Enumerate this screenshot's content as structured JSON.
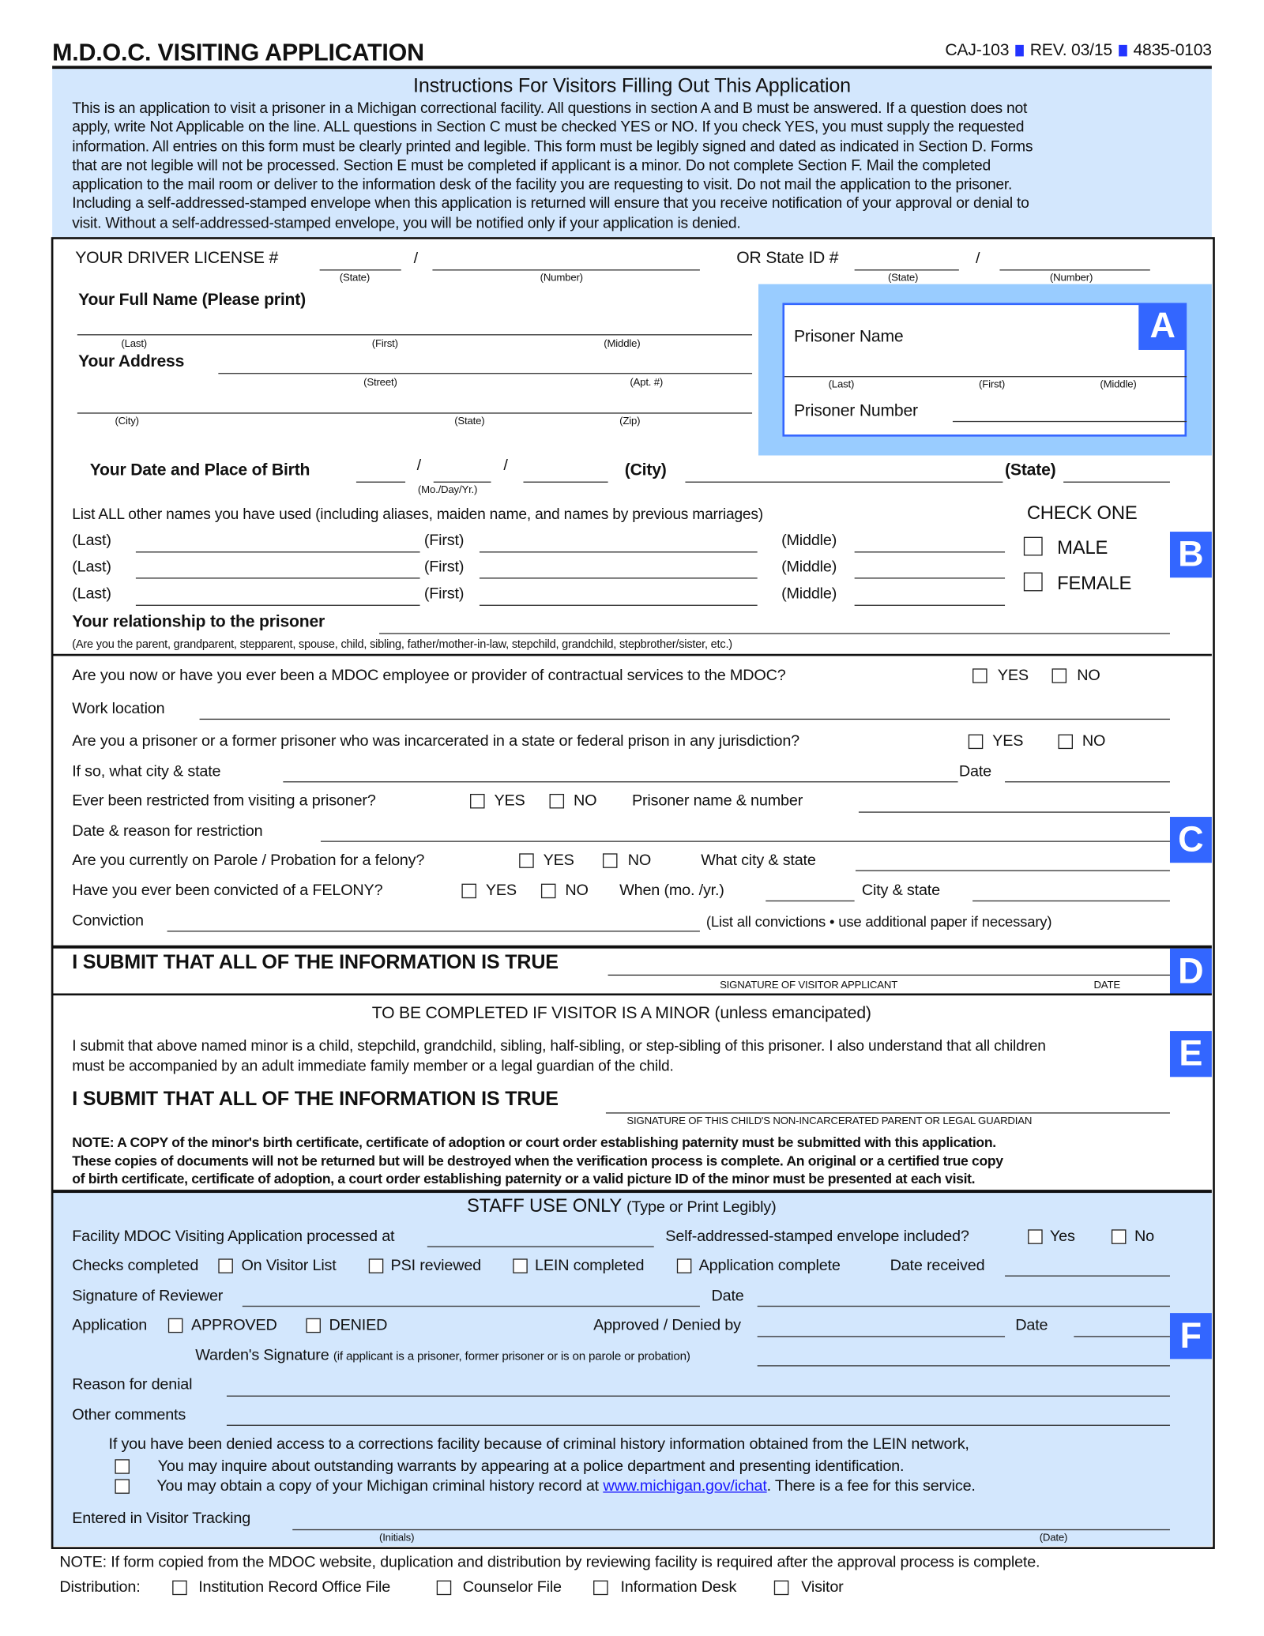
{
  "header": {
    "title": "M.D.O.C. VISITING APPLICATION",
    "form_no": "CAJ-103",
    "rev": "REV. 03/15",
    "code": "4835-0103"
  },
  "instructions": {
    "heading": "Instructions For Visitors Filling Out This Application",
    "lines": [
      "This is an application to visit a prisoner in a Michigan correctional facility.  All questions in section A and B must be answered. If a question does not",
      "apply, write Not Applicable on the line. ALL questions in Section C must be checked YES or NO. If you check YES, you must supply the requested",
      "information.  All entries on this form must be clearly printed and legible. This form must be legibly signed and dated as indicated in Section D. Forms",
      "that are not legible will not be processed. Section E must be completed if applicant is a minor. Do not complete Section F. Mail the completed",
      "application to the mail room or deliver to the information desk of the facility you are requesting to visit.  Do not mail the application to the prisoner.",
      "Including a self-addressed-stamped envelope when this application is returned will ensure that you receive notification of your approval or denial to",
      "visit.  Without a self-addressed-stamped envelope, you will be notified only if your application is denied."
    ]
  },
  "license": {
    "label": "YOUR DRIVER LICENSE #",
    "slash": "/",
    "state": "(State)",
    "number": "(Number)",
    "state_id_label": "OR State ID #"
  },
  "section_a": {
    "letter": "A",
    "prisoner_name": "Prisoner Name",
    "last": "(Last)",
    "first": "(First)",
    "middle": "(Middle)",
    "prisoner_number": "Prisoner Number"
  },
  "personal": {
    "full_name": "Your Full Name (Please print)",
    "last": "(Last)",
    "first": "(First)",
    "middle": "(Middle)",
    "address": "Your Address",
    "street": "(Street)",
    "apt": "(Apt. #)",
    "city": "(City)",
    "state": "(State)",
    "zip": "(Zip)",
    "dob": "Your Date and Place of Birth",
    "dob_hint": "(Mo./Day/Yr.)",
    "dob_city": "(City)",
    "dob_state": "(State)"
  },
  "section_b": {
    "letter": "B",
    "other_names": "List ALL other names you have used (including aliases, maiden name, and names by previous marriages)",
    "last": "(Last)",
    "first": "(First)",
    "middle": "(Middle)",
    "check_one": "CHECK ONE",
    "male": "MALE",
    "female": "FEMALE",
    "relationship": "Your relationship to the prisoner",
    "relationship_hint": "(Are you the parent, grandparent, stepparent, spouse, child, sibling, father/mother-in-law, stepchild, grandchild, stepbrother/sister, etc.)"
  },
  "section_c": {
    "letter": "C",
    "yes": "YES",
    "no": "NO",
    "q_employee": "Are you now or have you ever been a MDOC employee or provider of contractual services to the MDOC?",
    "work_location": "Work location",
    "q_prisoner": "Are you a prisoner or a former prisoner who was incarcerated in a state or federal prison in any jurisdiction?",
    "city_state": "If so, what city & state",
    "date": "Date",
    "q_restricted": "Ever been restricted from visiting a prisoner?",
    "prisoner_name_number": "Prisoner name & number",
    "date_reason": "Date & reason for restriction",
    "q_parole": "Are you currently on Parole / Probation for a felony?",
    "what_city_state": "What city & state",
    "q_felony": "Have you ever been convicted of a FELONY?",
    "when": "When (mo. /yr.)",
    "city_state2": "City & state",
    "conviction": "Conviction",
    "conviction_hint": "(List all convictions • use additional paper if necessary)"
  },
  "section_d": {
    "letter": "D",
    "statement": "I SUBMIT THAT ALL OF THE INFORMATION IS TRUE",
    "signature": "SIGNATURE OF VISITOR APPLICANT",
    "date": "DATE"
  },
  "section_e": {
    "letter": "E",
    "heading": "TO BE COMPLETED IF VISITOR IS A MINOR (unless emancipated)",
    "text": [
      "I submit that above named minor is a child, stepchild, grandchild, sibling, half-sibling, or step-sibling of this prisoner. I also understand that all children",
      "must be accompanied by an adult immediate family member or a legal guardian of the child."
    ],
    "statement": "I SUBMIT THAT ALL OF THE INFORMATION IS TRUE",
    "signature": "SIGNATURE OF THIS CHILD'S NON-INCARCERATED PARENT OR LEGAL GUARDIAN",
    "note": [
      "NOTE: A COPY of the minor's birth certificate, certificate of adoption or court order establishing paternity must be submitted with this application.",
      "These copies of documents will not be returned but will be destroyed when the verification process is complete.  An original or a certified true copy",
      "of birth certificate, certificate of adoption, a court order establishing paternity or a valid picture ID of the minor must be presented at each visit."
    ]
  },
  "section_f": {
    "letter": "F",
    "heading": "STAFF USE ONLY",
    "heading_sub": "(Type or Print Legibly)",
    "processed_at": "Facility MDOC Visiting Application processed at",
    "envelope": "Self-addressed-stamped envelope included?",
    "yes": "Yes",
    "no": "No",
    "checks": "Checks completed",
    "on_visitor_list": "On Visitor List",
    "psi": "PSI reviewed",
    "lein": "LEIN completed",
    "app_complete": "Application complete",
    "date_received": "Date received",
    "reviewer_sig": "Signature of Reviewer",
    "date": "Date",
    "application": "Application",
    "approved": "APPROVED",
    "denied": "DENIED",
    "approved_by": "Approved / Denied by",
    "warden": "Warden's Signature",
    "warden_hint": "(if applicant is a prisoner, former prisoner or is on parole or probation)",
    "reason": "Reason for denial",
    "comments": "Other comments",
    "lein_intro": "If you have been denied access to a corrections facility because of criminal history information obtained from the LEIN network,",
    "lein_1": "You may inquire about outstanding warrants by appearing at a police department and presenting identification.",
    "lein_2_pre": "You may obtain a copy of your Michigan criminal history record at",
    "lein_link": "www.michigan.gov/ichat",
    "lein_2_post": ".  There is a fee for this service.",
    "tracking": "Entered in Visitor Tracking",
    "initials": "(Initials)",
    "tracking_date": "(Date)"
  },
  "footer": {
    "note": "NOTE:  If form copied from the MDOC website, duplication and distribution by reviewing facility is required after the approval process is complete.",
    "distribution": "Distribution:",
    "items": [
      "Institution Record Office File",
      "Counselor File",
      "Information Desk",
      "Visitor"
    ]
  },
  "colors": {
    "section_bg": "#d3e7fd",
    "section_a_bg": "#99ccff",
    "letter_bg": "#3366ff",
    "link": "#1a1aff"
  }
}
